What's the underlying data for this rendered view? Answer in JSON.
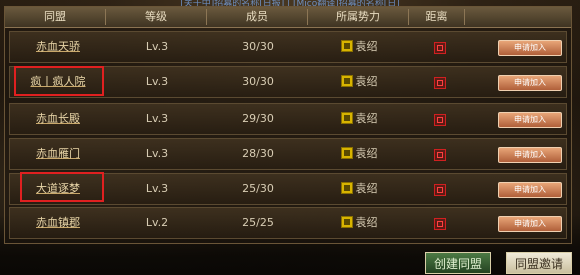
{
  "top_banner": {
    "text": "[关于中]招募的名称[日报] | [Mico翻译]招募的名称[日]"
  },
  "table": {
    "headers": [
      "同盟",
      "等级",
      "成员",
      "所属势力",
      "距离",
      ""
    ],
    "apply_label": "申请加入",
    "rows": [
      {
        "name": "赤血天骄",
        "level": "Lv.3",
        "members": "30/30",
        "force": "袁绍"
      },
      {
        "name": "疯丨疯人院",
        "level": "Lv.3",
        "members": "30/30",
        "force": "袁绍"
      },
      {
        "name": "赤血长殿",
        "level": "Lv.3",
        "members": "29/30",
        "force": "袁绍"
      },
      {
        "name": "赤血雁门",
        "level": "Lv.3",
        "members": "28/30",
        "force": "袁绍"
      },
      {
        "name": "大道逐梦",
        "level": "Lv.3",
        "members": "25/30",
        "force": "袁绍"
      },
      {
        "name": "赤血镇郡",
        "level": "Lv.2",
        "members": "25/25",
        "force": "袁绍"
      }
    ]
  },
  "buttons": {
    "create": "创建同盟",
    "invite": "同盟邀请"
  },
  "colors": {
    "force_badge": "#d8b400",
    "highlight": "#e02020",
    "apply": "#c87448"
  }
}
